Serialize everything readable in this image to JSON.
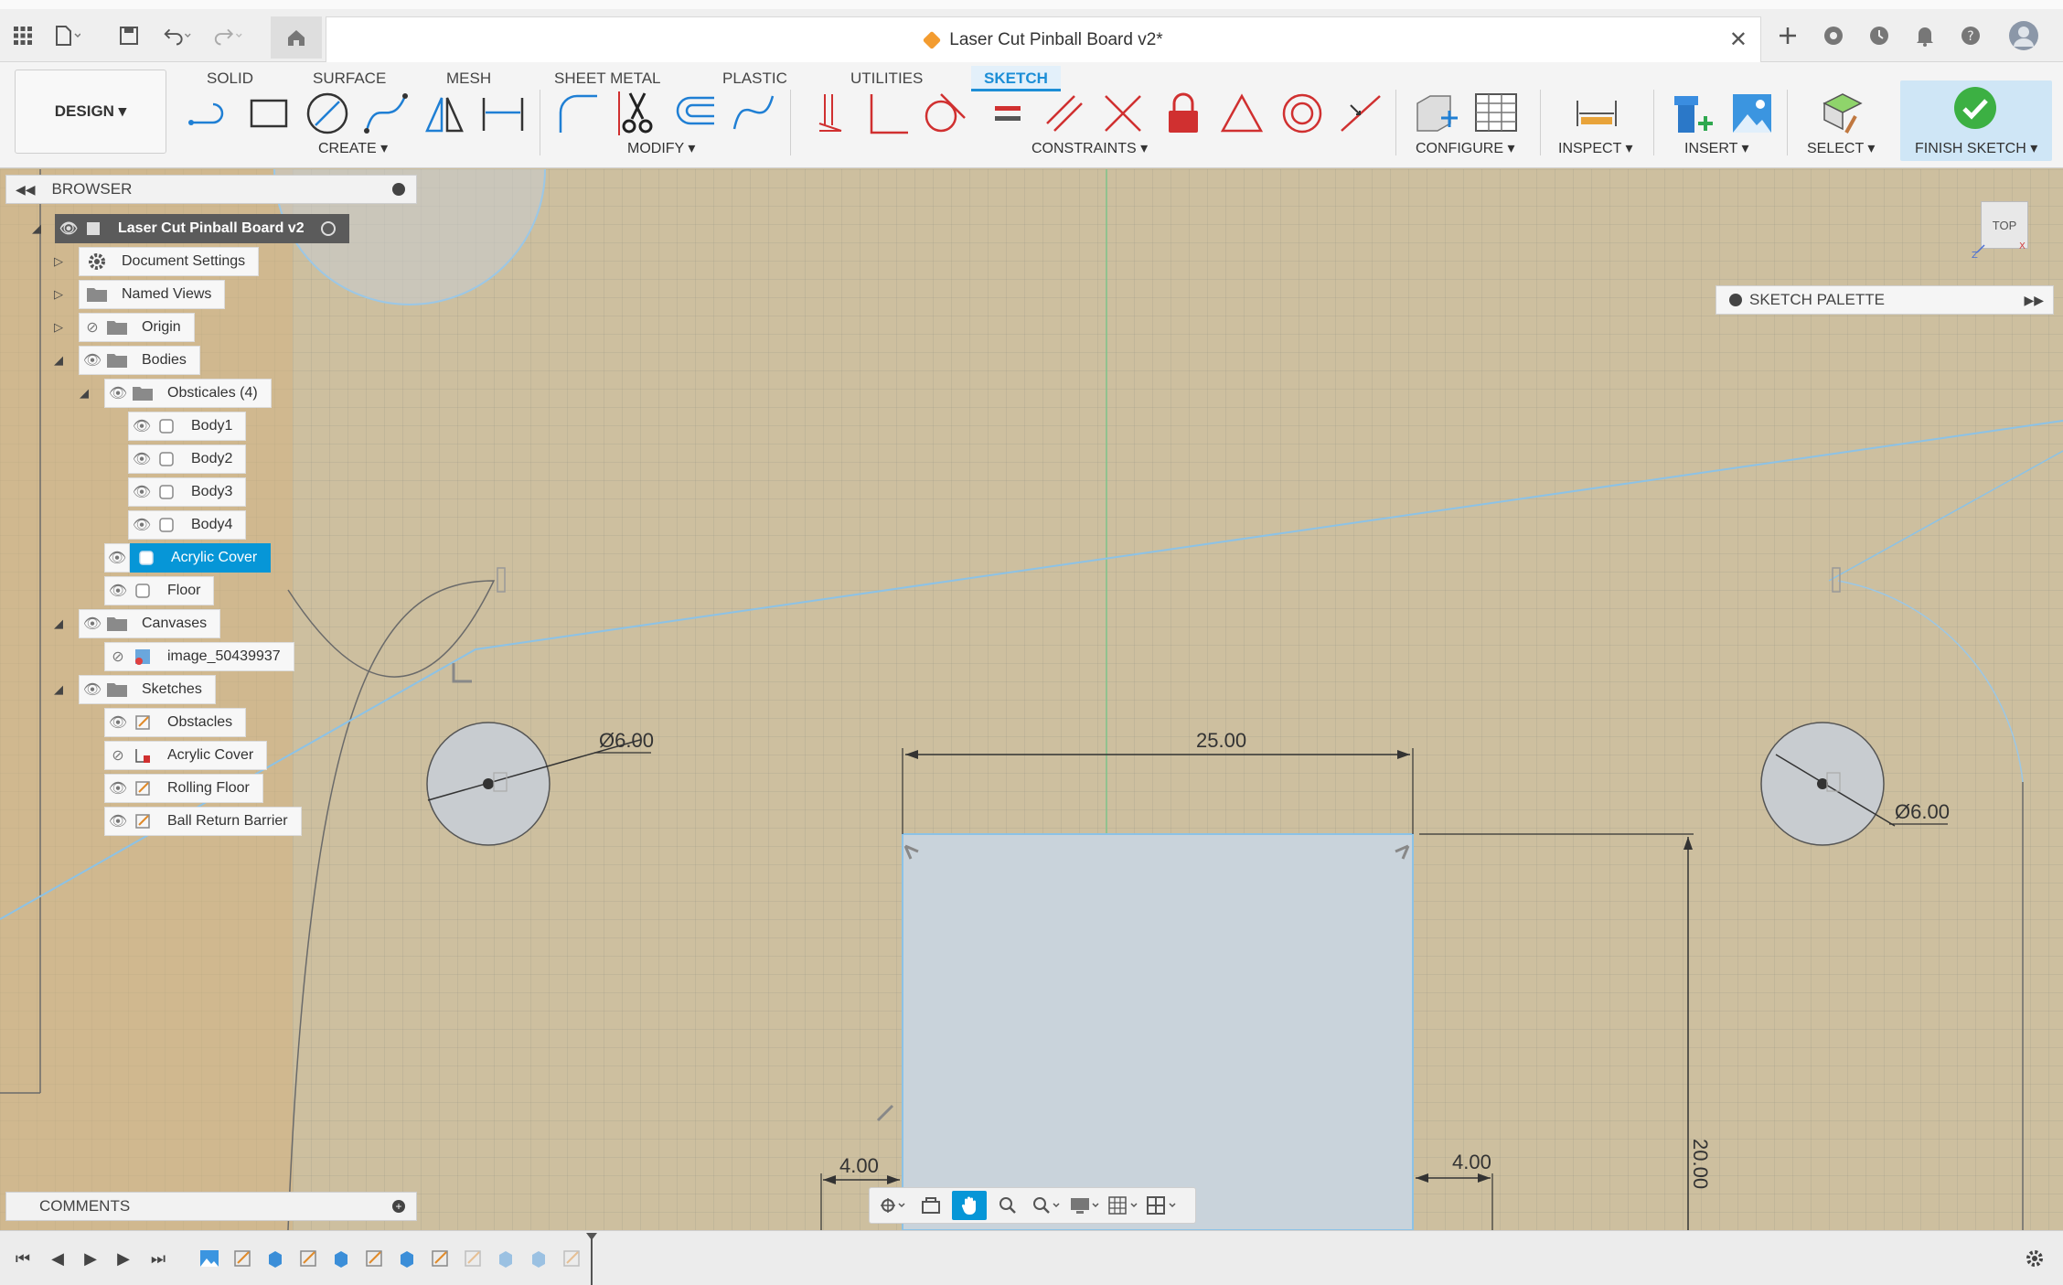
{
  "app": {
    "document_title": "Laser Cut Pinball Board v2*"
  },
  "ribbon": {
    "workspace_label": "DESIGN",
    "tabs": [
      {
        "label": "SOLID",
        "active": false
      },
      {
        "label": "SURFACE",
        "active": false
      },
      {
        "label": "MESH",
        "active": false
      },
      {
        "label": "SHEET METAL",
        "active": false
      },
      {
        "label": "PLASTIC",
        "active": false
      },
      {
        "label": "UTILITIES",
        "active": false
      },
      {
        "label": "SKETCH",
        "active": true
      }
    ],
    "groups": {
      "create": "CREATE",
      "modify": "MODIFY",
      "constraints": "CONSTRAINTS",
      "configure": "CONFIGURE",
      "inspect": "INSPECT",
      "insert": "INSERT",
      "select": "SELECT",
      "finish": "FINISH SKETCH"
    },
    "accent_color": "#1c8ed6"
  },
  "browser": {
    "title": "BROWSER",
    "root": "Laser Cut Pinball Board v2",
    "items": [
      {
        "label": "Document Settings"
      },
      {
        "label": "Named Views"
      },
      {
        "label": "Origin"
      },
      {
        "label": "Bodies"
      },
      {
        "label": "Obsticales (4)"
      },
      {
        "label": "Body1"
      },
      {
        "label": "Body2"
      },
      {
        "label": "Body3"
      },
      {
        "label": "Body4"
      },
      {
        "label": "Acrylic Cover",
        "selected": true
      },
      {
        "label": "Floor"
      },
      {
        "label": "Canvases"
      },
      {
        "label": "image_50439937"
      },
      {
        "label": "Sketches"
      },
      {
        "label": "Obstacles"
      },
      {
        "label": "Acrylic Cover"
      },
      {
        "label": "Rolling Floor"
      },
      {
        "label": "Ball Return Barrier"
      }
    ]
  },
  "palette": {
    "title": "SKETCH PALETTE"
  },
  "viewcube": {
    "face": "TOP"
  },
  "comments": {
    "title": "COMMENTS"
  },
  "dimensions": {
    "left_circle": "Ø6.00",
    "right_circle": "Ø6.00",
    "rect_width": "25.00",
    "rect_height": "20.00",
    "left_offset": "4.00",
    "right_offset": "4.00"
  }
}
